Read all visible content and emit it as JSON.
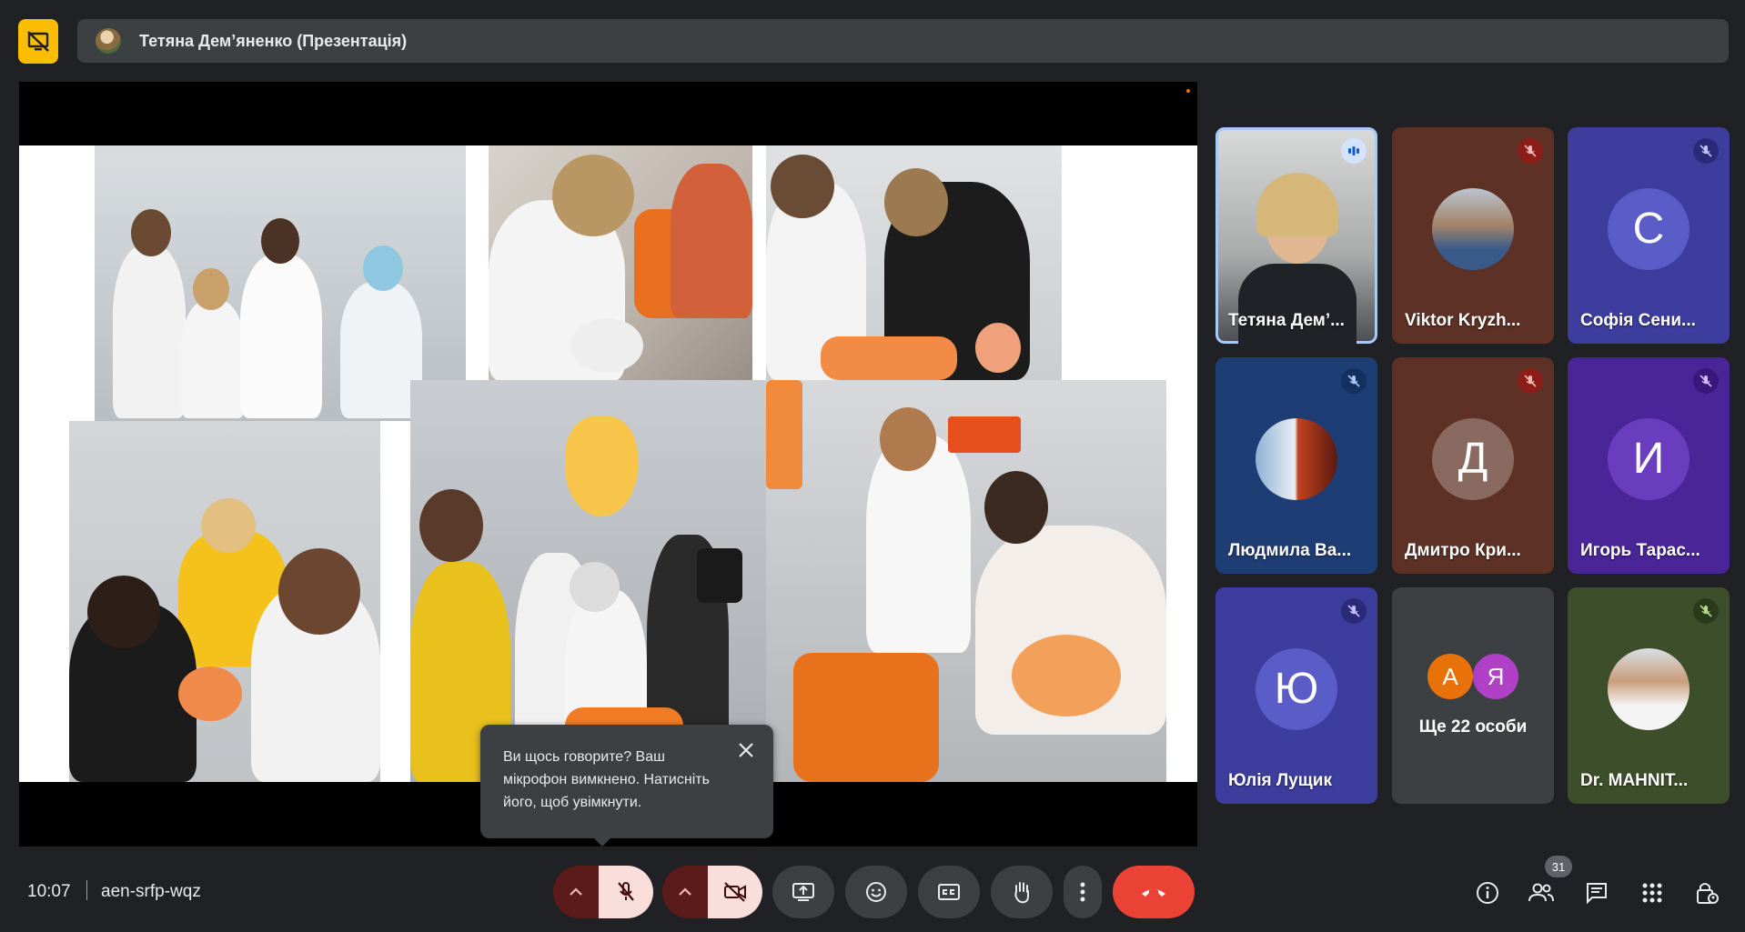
{
  "presenter_bar": {
    "label": "Тетяна Дем’яненко (Презентація)"
  },
  "tooltip": {
    "text": "Ви щось говорите? Ваш мікрофон вимкнено. Натисніть його, щоб увімкнути."
  },
  "participants": [
    {
      "name": "Тетяна Дем’...",
      "mic": "speaking"
    },
    {
      "name": "Viktor Kryzh...",
      "mic": "muted"
    },
    {
      "name": "Софія Сени...",
      "mic": "muted",
      "initial": "С"
    },
    {
      "name": "Людмила Ва...",
      "mic": "muted"
    },
    {
      "name": "Дмитро Кри...",
      "mic": "muted",
      "initial": "Д"
    },
    {
      "name": "Игорь Тарас...",
      "mic": "muted",
      "initial": "И"
    },
    {
      "name": "Юлія Лущик",
      "mic": "muted",
      "initial": "Ю"
    },
    {
      "name": "Ще 22 особи",
      "initials": [
        "А",
        "Я"
      ]
    },
    {
      "name": "Dr. MAHNIT...",
      "mic": "muted"
    }
  ],
  "bottom_bar": {
    "time": "10:07",
    "meeting_code": "aen-srfp-wqz",
    "people_count": "31"
  },
  "colors": {
    "background": "#202124",
    "surface": "#3c4043",
    "presenting_badge": "#fbbc04",
    "end_call": "#ea4335",
    "muted_control": "#f6d1cf"
  }
}
